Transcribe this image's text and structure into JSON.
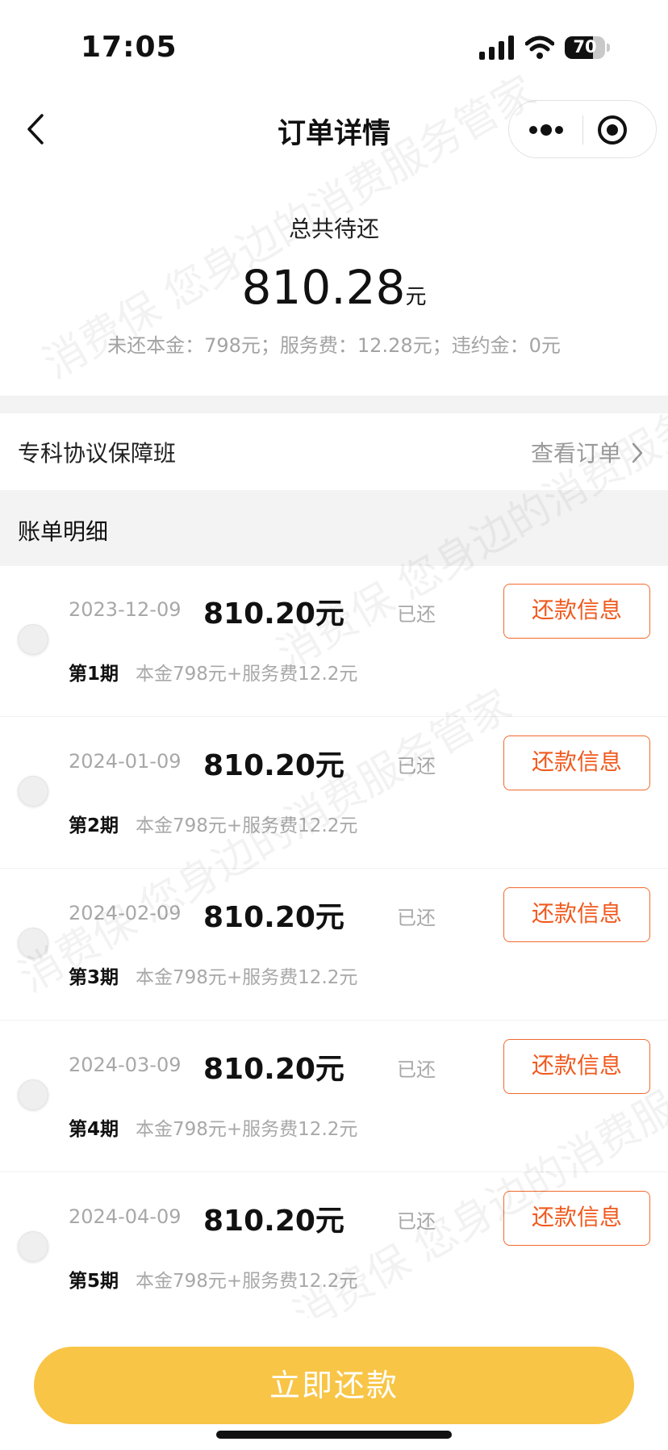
{
  "status_bar": {
    "time": "17:05",
    "battery_level": "70",
    "battery_fraction": 0.7
  },
  "nav": {
    "title": "订单详情"
  },
  "summary": {
    "label": "总共待还",
    "amount": "810.28",
    "unit": "元",
    "breakdown": "未还本金：798元；服务费：12.28元；违约金：0元"
  },
  "order": {
    "name": "专科协议保障班",
    "view_label": "查看订单"
  },
  "details": {
    "title": "账单明细",
    "items": [
      {
        "date": "2023-12-09",
        "amount": "810.20元",
        "status": "已还",
        "button": "还款信息",
        "period": "第1期",
        "desc": "本金798元+服务费12.2元"
      },
      {
        "date": "2024-01-09",
        "amount": "810.20元",
        "status": "已还",
        "button": "还款信息",
        "period": "第2期",
        "desc": "本金798元+服务费12.2元"
      },
      {
        "date": "2024-02-09",
        "amount": "810.20元",
        "status": "已还",
        "button": "还款信息",
        "period": "第3期",
        "desc": "本金798元+服务费12.2元"
      },
      {
        "date": "2024-03-09",
        "amount": "810.20元",
        "status": "已还",
        "button": "还款信息",
        "period": "第4期",
        "desc": "本金798元+服务费12.2元"
      },
      {
        "date": "2024-04-09",
        "amount": "810.20元",
        "status": "已还",
        "button": "还款信息",
        "period": "第5期",
        "desc": "本金798元+服务费12.2元"
      }
    ]
  },
  "footer": {
    "pay_label": "立即还款"
  },
  "watermark": {
    "text": "消费保 您身边的消费服务管家"
  },
  "colors": {
    "accent": "#f05a1e",
    "primary_button": "#f8c546",
    "gray_section": "#f3f3f3"
  },
  "icons": {
    "back": "chevron-left-icon",
    "more": "more-dots-icon",
    "target": "target-icon",
    "chevron": "chevron-right-icon"
  }
}
